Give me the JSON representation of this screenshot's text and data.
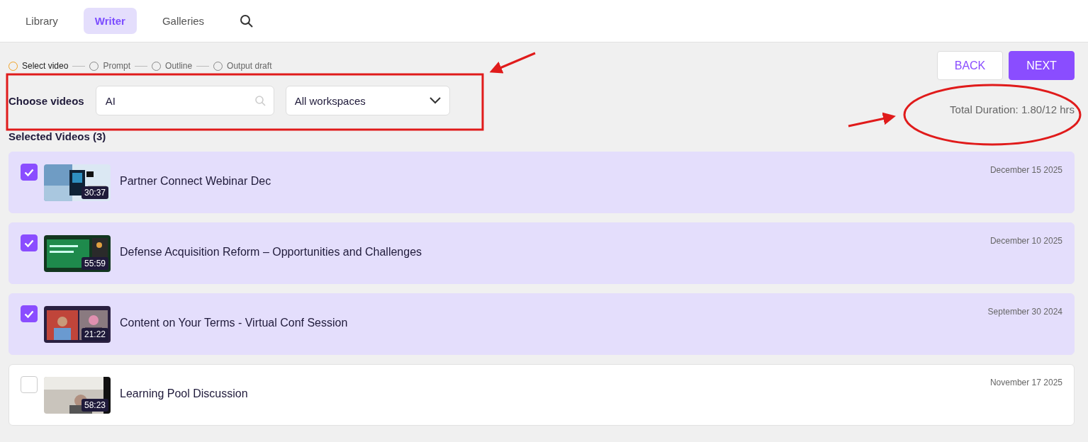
{
  "tabs": [
    {
      "label": "Library",
      "selected": false
    },
    {
      "label": "Writer",
      "selected": true
    },
    {
      "label": "Galleries",
      "selected": false
    }
  ],
  "steps": [
    {
      "label": "Select video",
      "selected": true
    },
    {
      "label": "Prompt",
      "selected": false
    },
    {
      "label": "Outline",
      "selected": false
    },
    {
      "label": "Output draft",
      "selected": false
    }
  ],
  "filters": {
    "label": "Choose videos",
    "search_value": "AI",
    "workspace": "All workspaces"
  },
  "buttons": {
    "back": "BACK",
    "next": "NEXT"
  },
  "total_duration": "Total Duration: 1.80/12 hrs",
  "selected_heading": "Selected Videos (3)",
  "videos": [
    {
      "title": "Partner Connect Webinar Dec",
      "duration": "30:37",
      "date": "December 15 2025",
      "checked": true
    },
    {
      "title": "Defense Acquisition Reform – Opportunities and Challenges",
      "duration": "55:59",
      "date": "December 10 2025",
      "checked": true
    },
    {
      "title": "Content on Your Terms - Virtual Conf Session",
      "duration": "21:22",
      "date": "September 30 2024",
      "checked": true
    },
    {
      "title": "Learning Pool Discussion",
      "duration": "58:23",
      "date": "November 17 2025",
      "checked": false
    }
  ]
}
